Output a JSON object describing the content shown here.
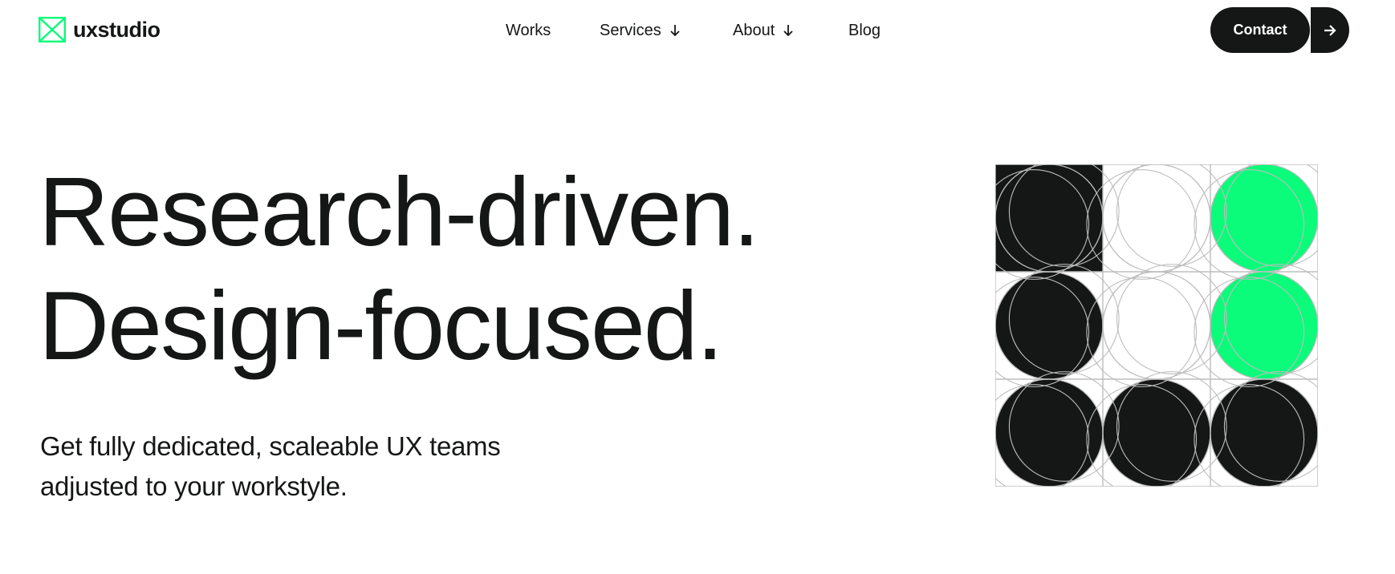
{
  "brand": {
    "name": "uxstudio",
    "logo_icon": "uxstudio-logo-icon",
    "accent_color": "#0bfb7a",
    "dark_color": "#151716"
  },
  "nav": {
    "items": [
      {
        "label": "Works",
        "has_dropdown": false
      },
      {
        "label": "Services",
        "has_dropdown": true,
        "icon": "arrow-down-icon"
      },
      {
        "label": "About",
        "has_dropdown": true,
        "icon": "arrow-down-icon"
      },
      {
        "label": "Blog",
        "has_dropdown": false
      }
    ],
    "contact_label": "Contact",
    "contact_icon": "arrow-right-icon"
  },
  "hero": {
    "headline_line1": "Research-driven.",
    "headline_line2": "Design-focused.",
    "subheadline_line1": "Get fully dedicated, scaleable UX teams",
    "subheadline_line2": "adjusted to your workstyle."
  },
  "graphic": {
    "rows": 3,
    "cols": 3,
    "cell_fills": [
      [
        "dark",
        "white",
        "accent"
      ],
      [
        "dark",
        "white",
        "accent"
      ],
      [
        "dark",
        "dark",
        "dark"
      ]
    ],
    "line_color": "#bdbdbd"
  }
}
